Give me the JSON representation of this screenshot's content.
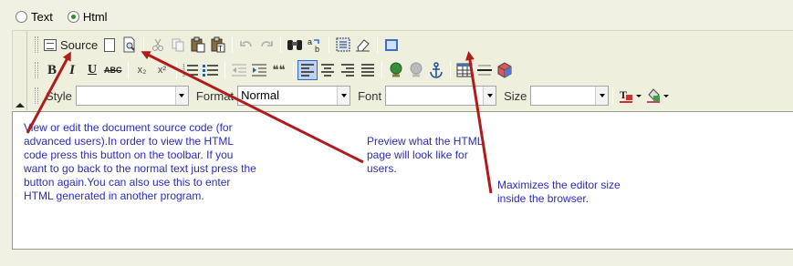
{
  "mode": {
    "options": [
      {
        "label": "Text",
        "checked": false
      },
      {
        "label": "Html",
        "checked": true
      }
    ]
  },
  "toolbar": {
    "source_label": "Source",
    "style_label": "Style",
    "format_label": "Format",
    "format_value": "Normal",
    "font_label": "Font",
    "size_label": "Size",
    "style_value": "",
    "font_value": "",
    "size_value": "",
    "buttons_row1": [
      "source-icon",
      "new-page-icon",
      "preview-icon",
      "cut-icon",
      "copy-icon",
      "paste-icon",
      "paste-text-icon",
      "undo-icon",
      "redo-icon",
      "find-icon",
      "replace-icon",
      "select-all-icon",
      "remove-format-icon",
      "maximize-icon"
    ],
    "buttons_row2": [
      "bold-icon",
      "italic-icon",
      "underline-icon",
      "strike-icon",
      "subscript-icon",
      "superscript-icon",
      "ordered-list-icon",
      "unordered-list-icon",
      "outdent-icon",
      "indent-icon",
      "blockquote-icon",
      "align-left-icon",
      "align-center-icon",
      "align-right-icon",
      "justify-icon",
      "link-icon",
      "unlink-icon",
      "anchor-icon",
      "table-icon",
      "horizontal-rule-icon",
      "special-char-icon"
    ],
    "glyphs": {
      "bold": "B",
      "italic": "I",
      "underline": "U",
      "strike": "ABC",
      "subscript": "x₂",
      "superscript": "x²",
      "quote": "❝❝"
    }
  },
  "annotations": {
    "source_note": "View or edit the document source code (for advanced users).In order to view the HTML code press this button on the toolbar. If you want to go back to the normal text just press the button again.You can also use this to enter HTML generated in another program.",
    "preview_note": "Preview what the HTML page will look like for users.",
    "maximize_note": "Maximizes the editor size inside the browser."
  },
  "colors": {
    "annotation_text": "#2b2bbd",
    "arrow": "#b01c1c",
    "background": "#f1f1e3",
    "active_button": "#c1d2ee"
  }
}
